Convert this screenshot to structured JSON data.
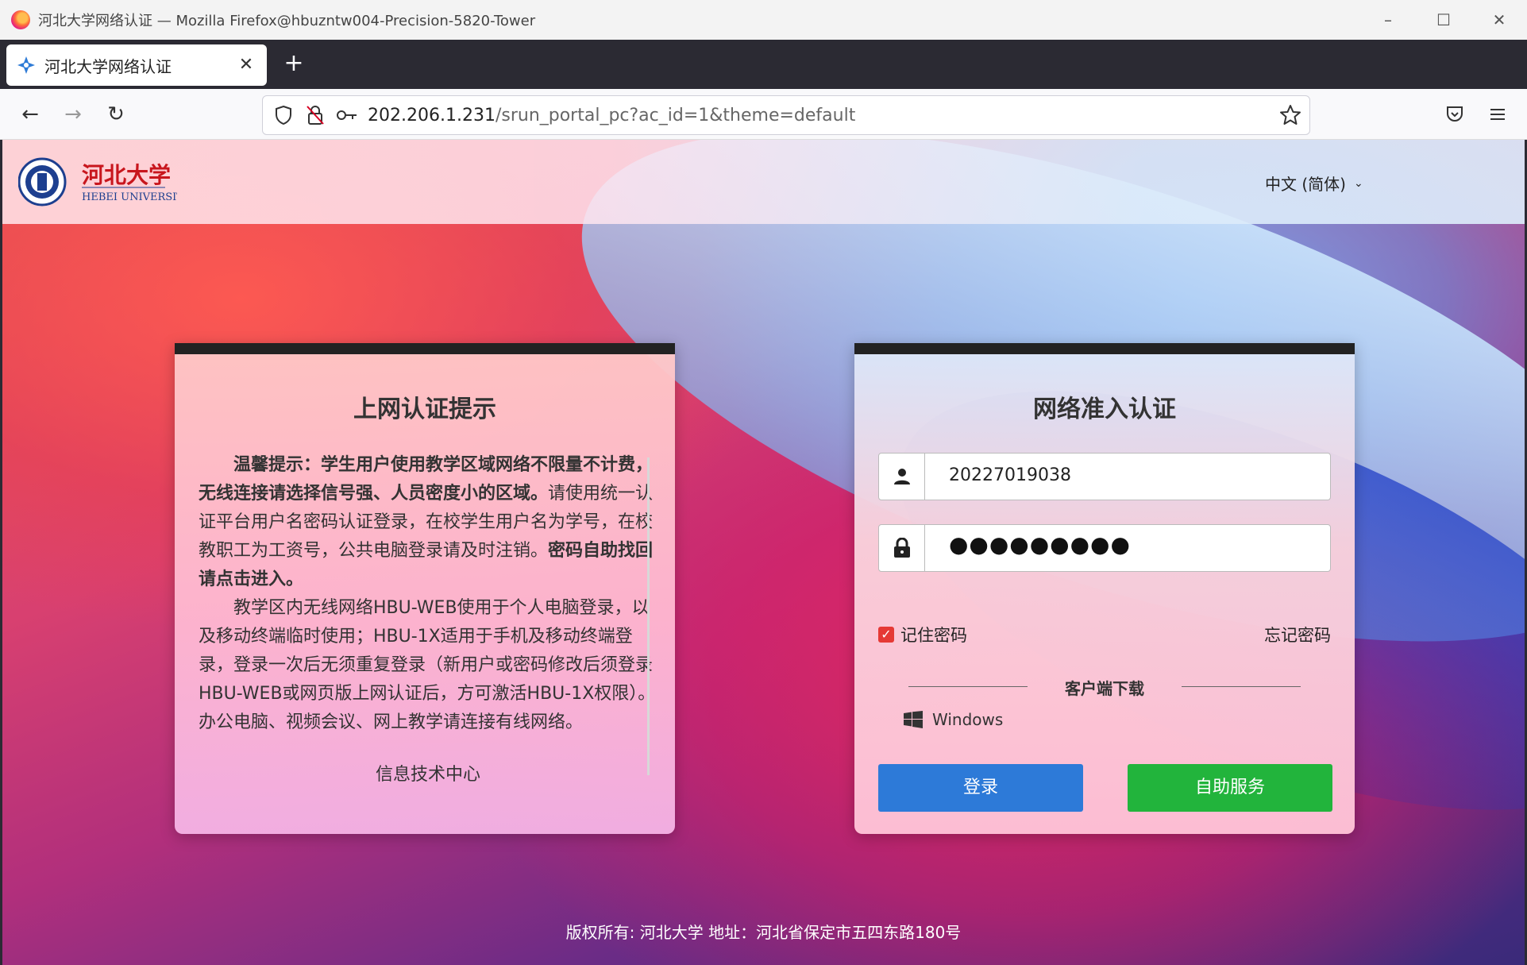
{
  "window": {
    "title": "河北大学网络认证 — Mozilla Firefox@hbuzntw004-Precision-5820-Tower",
    "controls": {
      "minimize": "–",
      "maximize": "☐",
      "close": "✕"
    }
  },
  "tab": {
    "title": "河北大学网络认证",
    "close": "✕",
    "new_tab": "+"
  },
  "navbar": {
    "back": "←",
    "forward": "→",
    "reload": "↻",
    "url_host": "202.206.1.231",
    "url_path": "/srun_portal_pc?ac_id=1&theme=default"
  },
  "header": {
    "language": "中文 (简体)",
    "language_chevron": "⌄"
  },
  "notice": {
    "title": "上网认证提示",
    "p1_bold": "温馨提示：学生用户使用教学区域网络不限量不计费，无线连接请选择信号强、人员密度小的区域。",
    "p1_rest": "请使用统一认证平台用户名密码认证登录，在校学生用户名为学号，在校教职工为工资号，公共电脑登录请及时注销。",
    "p1_bold2": "密码自助找回请点击进入。",
    "p2": "教学区内无线网络HBU-WEB使用于个人电脑登录，以及移动终端临时使用；HBU-1X适用于手机及移动终端登录，登录一次后无须重复登录（新用户或密码修改后须登录HBU-WEB或网页版上网认证后，方可激活HBU-1X权限）。办公电脑、视频会议、网上教学请连接有线网络。",
    "sign": "信息技术中心"
  },
  "login": {
    "title": "网络准入认证",
    "username": "20227019038",
    "password_mask": "●●●●●●●●●",
    "remember_label": "记住密码",
    "remember_checked": true,
    "forgot_label": "忘记密码",
    "download_title": "客户端下载",
    "windows_label": "Windows",
    "login_button": "登录",
    "self_service_button": "自助服务",
    "colors": {
      "login": "#2d7ad8",
      "self_service": "#22b43c",
      "checkbox": "#e53935"
    }
  },
  "footer": {
    "text": "版权所有: 河北大学 地址：河北省保定市五四东路180号"
  }
}
